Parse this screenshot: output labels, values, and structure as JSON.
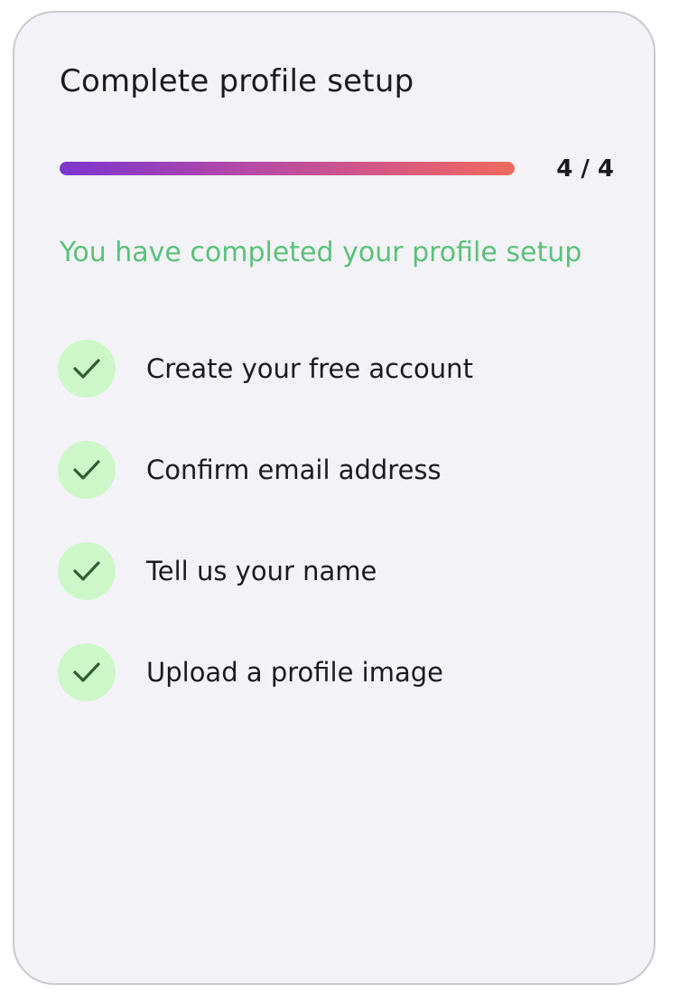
{
  "card": {
    "title": "Complete profile setup",
    "progress": {
      "completed": 4,
      "total": 4,
      "label": "4 / 4",
      "gradient_start": "#7b35cf",
      "gradient_end": "#ee6a5c"
    },
    "status_message": "You have completed your profile setup",
    "status_color": "#5ac27a",
    "steps": [
      {
        "label": "Create your free account",
        "done": true,
        "icon": "check-icon"
      },
      {
        "label": "Confirm email address",
        "done": true,
        "icon": "check-icon"
      },
      {
        "label": "Tell us your name",
        "done": true,
        "icon": "check-icon"
      },
      {
        "label": "Upload a profile image",
        "done": true,
        "icon": "check-icon"
      }
    ]
  }
}
